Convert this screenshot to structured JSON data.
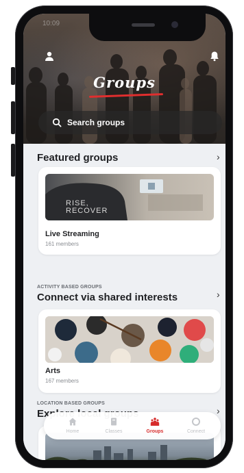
{
  "status": {
    "time": "10:09"
  },
  "header": {
    "title": "Groups"
  },
  "search": {
    "placeholder": "Search groups"
  },
  "featured": {
    "title": "Featured groups",
    "card": {
      "name": "Live Streaming",
      "members": "161 members",
      "image_text": "RISE, RECOVER"
    }
  },
  "activity": {
    "eyebrow": "ACTIVITY BASED GROUPS",
    "title": "Connect via shared interests",
    "card": {
      "name": "Arts",
      "members": "167 members"
    }
  },
  "location": {
    "eyebrow": "LOCATION BASED GROUPS",
    "title": "Explore local groups"
  },
  "tabbar": {
    "tabs": [
      {
        "label": "Home",
        "icon": "home-icon",
        "active": false
      },
      {
        "label": "Classes",
        "icon": "classes-icon",
        "active": false
      },
      {
        "label": "Groups",
        "icon": "groups-icon",
        "active": true
      },
      {
        "label": "Connect",
        "icon": "connect-icon",
        "active": false
      }
    ]
  },
  "colors": {
    "accent": "#d62b2b",
    "background": "#eef0f3"
  }
}
